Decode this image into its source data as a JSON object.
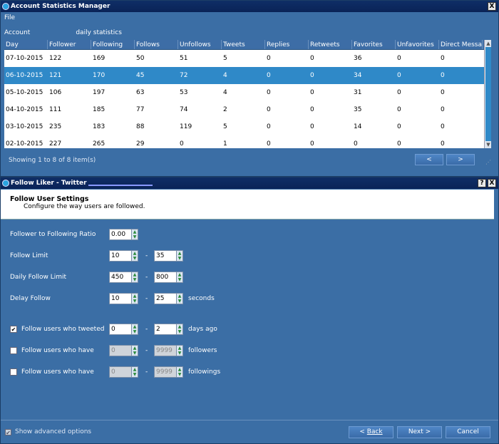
{
  "stats_window": {
    "title": "Account Statistics Manager",
    "menu": [
      "File"
    ],
    "account_label": "Account",
    "account_value": "",
    "daily_statistics_label": "daily statistics",
    "table": {
      "columns": [
        "Day",
        "Follower",
        "Following",
        "Follows",
        "Unfollows",
        "Tweets",
        "Replies",
        "Retweets",
        "Favorites",
        "Unfavorites",
        "Direct Messa"
      ],
      "rows": [
        [
          "07-10-2015",
          "122",
          "169",
          "50",
          "51",
          "5",
          "0",
          "0",
          "36",
          "0",
          "0"
        ],
        [
          "06-10-2015",
          "121",
          "170",
          "45",
          "72",
          "4",
          "0",
          "0",
          "34",
          "0",
          "0"
        ],
        [
          "05-10-2015",
          "106",
          "197",
          "63",
          "53",
          "4",
          "0",
          "0",
          "31",
          "0",
          "0"
        ],
        [
          "04-10-2015",
          "111",
          "185",
          "77",
          "74",
          "2",
          "0",
          "0",
          "35",
          "0",
          "0"
        ],
        [
          "03-10-2015",
          "235",
          "183",
          "88",
          "119",
          "5",
          "0",
          "0",
          "14",
          "0",
          "0"
        ],
        [
          "02-10-2015",
          "227",
          "265",
          "29",
          "0",
          "1",
          "0",
          "0",
          "0",
          "0",
          "0"
        ]
      ],
      "selected_row_index": 1
    },
    "showing_text": "Showing 1 to 8 of 8 item(s)",
    "prev_label": "<",
    "next_label": ">",
    "close_label": "X"
  },
  "follow_window": {
    "title": "Follow Liker - Twitter",
    "help_label": "?",
    "close_label": "X",
    "header_title": "Follow User Settings",
    "header_subtitle": "Configure the way users are followed.",
    "ratio": {
      "label": "Follower to Following Ratio",
      "value": "0.00"
    },
    "follow_limit": {
      "label": "Follow Limit",
      "min": "10",
      "max": "35"
    },
    "daily_follow_limit": {
      "label": "Daily Follow Limit",
      "min": "450",
      "max": "800"
    },
    "delay_follow": {
      "label": "Delay Follow",
      "min": "10",
      "max": "25",
      "unit": "seconds"
    },
    "tweeted": {
      "checked": true,
      "label": "Follow users who tweeted",
      "min": "0",
      "max": "2",
      "unit": "days ago"
    },
    "followers_filter": {
      "checked": false,
      "label": "Follow users who have",
      "min": "0",
      "max": "9999",
      "unit": "followers"
    },
    "followings_filter": {
      "checked": false,
      "label": "Follow users who have",
      "min": "0",
      "max": "9999",
      "unit": "followings"
    },
    "dash": "-",
    "show_advanced": {
      "checked": true,
      "label": "Show advanced options"
    },
    "back_label": "Back",
    "next_label": "Next >",
    "cancel_label": "Cancel"
  }
}
